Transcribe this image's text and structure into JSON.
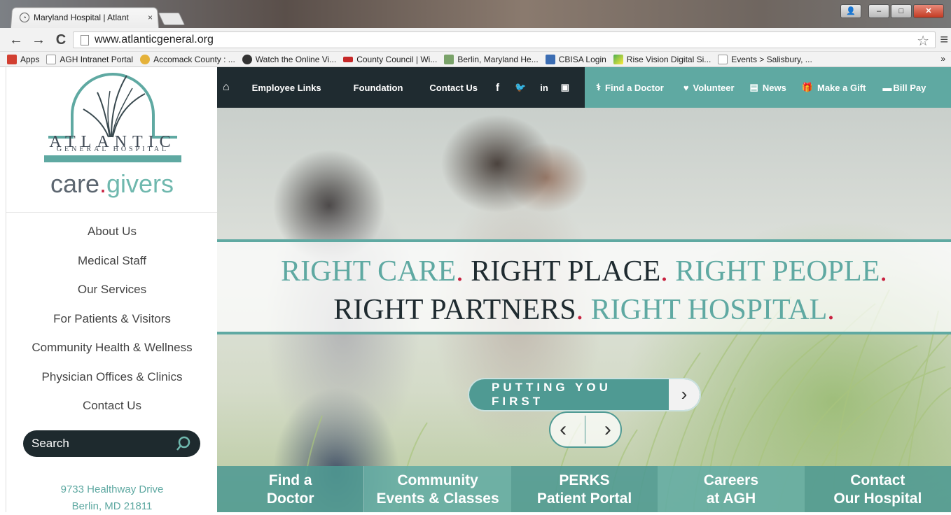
{
  "browser": {
    "tab_title": "Maryland Hospital | Atlant",
    "tab_close": "×",
    "url": "www.atlanticgeneral.org",
    "back": "←",
    "forward": "→",
    "reload": "C",
    "star": "☆",
    "menu": "≡",
    "bookmarks": [
      {
        "label": "Apps",
        "icon_color": "#d23f31"
      },
      {
        "label": "AGH Intranet Portal",
        "icon_color": "#dddddd"
      },
      {
        "label": "Accomack County : ...",
        "icon_color": "#3c8d3a"
      },
      {
        "label": "Watch the Online Vi...",
        "icon_color": "#333333"
      },
      {
        "label": "County Council | Wi...",
        "icon_color": "#c62828"
      },
      {
        "label": "Berlin, Maryland He...",
        "icon_color": "#7aa36a"
      },
      {
        "label": "CBISA Login",
        "icon_color": "#3b6db3"
      },
      {
        "label": "Rise Vision Digital Si...",
        "icon_color": "#4caf50"
      },
      {
        "label": "Events > Salisbury, ...",
        "icon_color": "#dddddd"
      }
    ],
    "bookmarks_more": "»"
  },
  "sidebar": {
    "logo_word1": "ATLANTIC",
    "logo_word2": "GENERAL HOSPITAL",
    "tagline_care": "care",
    "tagline_dot": ".",
    "tagline_givers": "givers",
    "nav": [
      "About Us",
      "Medical Staff",
      "Our Services",
      "For Patients & Visitors",
      "Community Health & Wellness",
      "Physician Offices & Clinics",
      "Contact Us"
    ],
    "search_placeholder": "Search",
    "address_line1": "9733 Healthway Drive",
    "address_line2": "Berlin, MD 21811"
  },
  "topnav": {
    "home": "⌂",
    "dark_links": [
      "Employee Links",
      "Foundation",
      "Contact Us"
    ],
    "social": [
      "f",
      "t",
      "in",
      "yt"
    ],
    "teal_links": [
      "Find a Doctor",
      "Volunteer",
      "News",
      "Make a Gift",
      "Bill Pay"
    ]
  },
  "hero": {
    "line1": [
      {
        "text": "RIGHT CARE",
        "style": "teal"
      },
      {
        "text": ".",
        "style": "dot"
      },
      {
        "text": " RIGHT PLACE",
        "style": "dark"
      },
      {
        "text": ".",
        "style": "dot"
      },
      {
        "text": " RIGHT PEOPLE",
        "style": "teal"
      },
      {
        "text": ".",
        "style": "dot"
      }
    ],
    "line2": [
      {
        "text": "RIGHT PARTNERS",
        "style": "dark"
      },
      {
        "text": ".",
        "style": "dot"
      },
      {
        "text": " RIGHT HOSPITAL",
        "style": "teal"
      },
      {
        "text": ".",
        "style": "dot"
      }
    ],
    "cta_label": "PUTTING YOU FIRST",
    "cta_arrow": "›",
    "prev": "‹",
    "next": "›"
  },
  "tiles": [
    {
      "line1": "Find a",
      "line2": "Doctor"
    },
    {
      "line1": "Community",
      "line2": "Events & Classes"
    },
    {
      "line1": "PERKS",
      "line2": "Patient Portal"
    },
    {
      "line1": "Careers",
      "line2": "at AGH"
    },
    {
      "line1": "Contact",
      "line2": "Our Hospital"
    }
  ],
  "colors": {
    "teal": "#5fa9a2",
    "dark_nav": "#1f2b30",
    "accent_red": "#c8213f"
  }
}
